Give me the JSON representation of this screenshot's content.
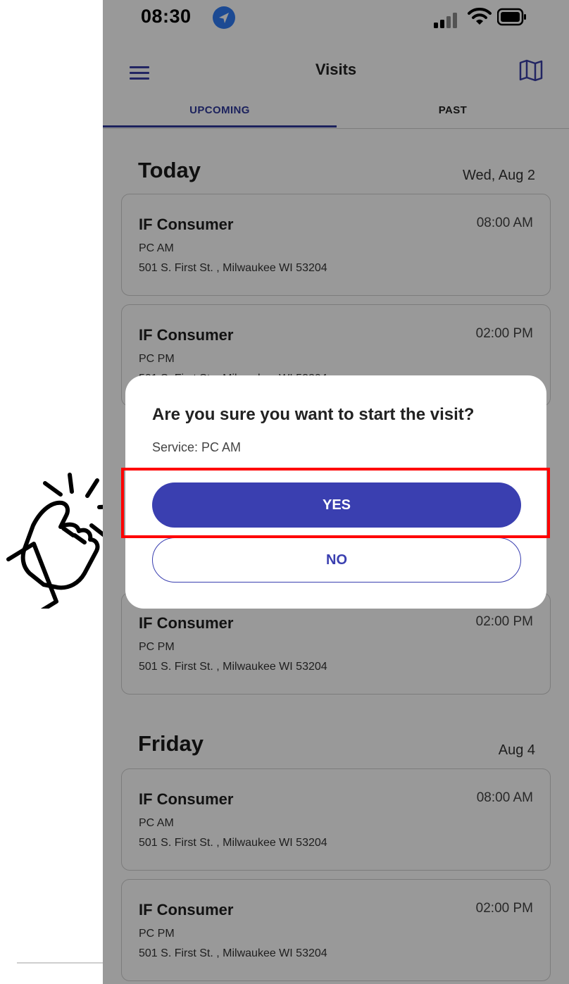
{
  "status_bar": {
    "time": "08:30"
  },
  "header": {
    "title": "Visits"
  },
  "tabs": [
    {
      "label": "UPCOMING",
      "active": true
    },
    {
      "label": "PAST",
      "active": false
    }
  ],
  "sections": [
    {
      "heading": "Today",
      "date": "Wed, Aug 2",
      "visits": [
        {
          "name": "IF Consumer",
          "service": "PC AM",
          "address": "501 S. First St. , Milwaukee WI 53204",
          "time": "08:00 AM"
        },
        {
          "name": "IF Consumer",
          "service": "PC PM",
          "address": "501 S. First St. , Milwaukee WI 53204",
          "time": "02:00 PM"
        },
        {
          "name": "IF Consumer",
          "service": "PC PM",
          "address": "501 S. First St. , Milwaukee WI 53204",
          "time": "02:00 PM"
        }
      ]
    },
    {
      "heading": "Friday",
      "date": "Aug 4",
      "visits": [
        {
          "name": "IF Consumer",
          "service": "PC AM",
          "address": "501 S. First St. , Milwaukee WI 53204",
          "time": "08:00 AM"
        },
        {
          "name": "IF Consumer",
          "service": "PC PM",
          "address": "501 S. First St. , Milwaukee WI 53204",
          "time": "02:00 PM"
        }
      ]
    }
  ],
  "dialog": {
    "question": "Are you sure you want to start the visit?",
    "service": "Service: PC AM",
    "yes_label": "YES",
    "no_label": "NO"
  },
  "colors": {
    "accent": "#3a3fb0",
    "highlight": "#ff0000",
    "location_badge": "#2f7cf6"
  },
  "icons": [
    "location-arrow-icon",
    "signal-icon",
    "wifi-icon",
    "battery-icon",
    "menu-icon",
    "map-icon",
    "pointing-hand-icon"
  ]
}
